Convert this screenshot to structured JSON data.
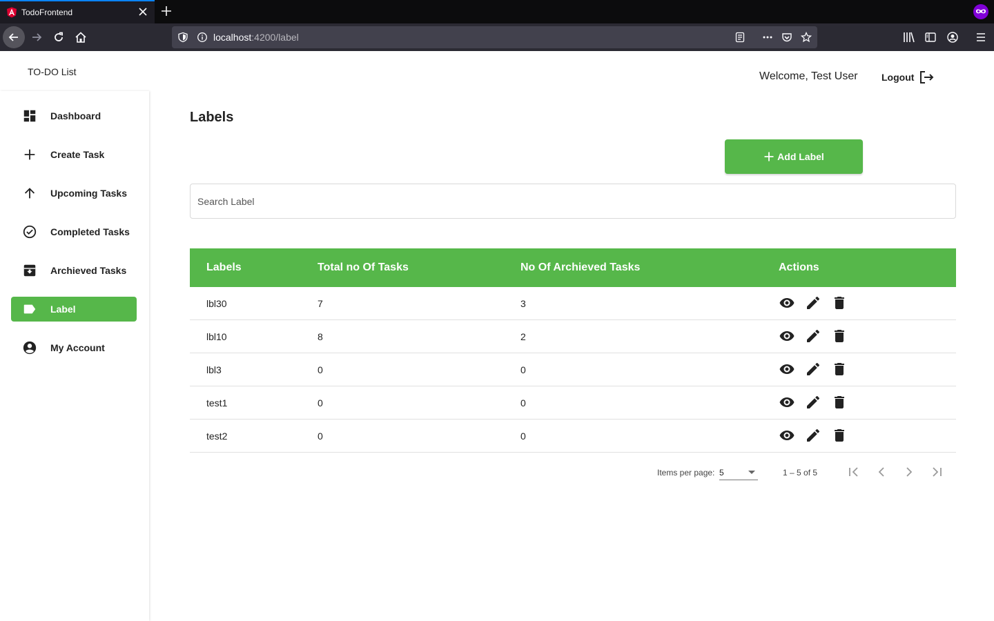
{
  "browser": {
    "tab_title": "TodoFrontend",
    "url_host": "localhost",
    "url_path": ":4200/label"
  },
  "header": {
    "app_title": "TO-DO List",
    "welcome": "Welcome, Test User",
    "logout_label": "Logout"
  },
  "sidebar": {
    "items": [
      {
        "label": "Dashboard",
        "icon": "dashboard-icon"
      },
      {
        "label": "Create Task",
        "icon": "plus-icon"
      },
      {
        "label": "Upcoming Tasks",
        "icon": "arrow-up-icon"
      },
      {
        "label": "Completed Tasks",
        "icon": "check-circle-icon"
      },
      {
        "label": "Archieved Tasks",
        "icon": "archive-icon"
      },
      {
        "label": "Label",
        "icon": "label-icon",
        "active": true
      },
      {
        "label": "My Account",
        "icon": "account-circle-icon"
      }
    ]
  },
  "main": {
    "title": "Labels",
    "add_button_label": "Add Label",
    "search_placeholder": "Search Label"
  },
  "table": {
    "headers": [
      "Labels",
      "Total no Of Tasks",
      "No Of Archieved Tasks",
      "Actions"
    ],
    "rows": [
      [
        "lbl30",
        "7",
        "3"
      ],
      [
        "lbl10",
        "8",
        "2"
      ],
      [
        "lbl3",
        "0",
        "0"
      ],
      [
        "test1",
        "0",
        "0"
      ],
      [
        "test2",
        "0",
        "0"
      ]
    ]
  },
  "paginator": {
    "items_per_page_label": "Items per page:",
    "items_per_page_value": "5",
    "range_label": "1 – 5 of 5"
  },
  "colors": {
    "accent": "#56b74a",
    "browser_bg": "#0c0c0d"
  }
}
